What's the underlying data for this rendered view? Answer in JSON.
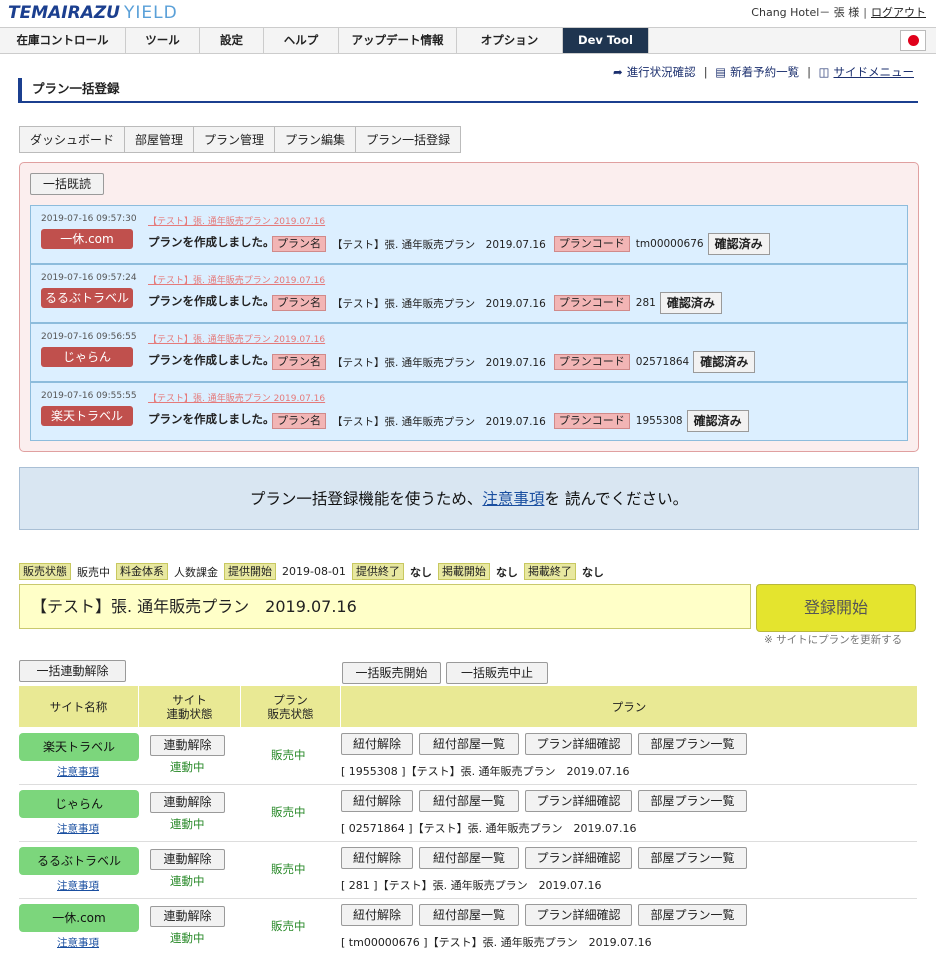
{
  "header": {
    "logo_part1": "TEMAIRAZU",
    "logo_part2": "YIELD",
    "hotel": "Chang Hotel－ 張 様",
    "logout": "ログアウト"
  },
  "nav": [
    "在庫コントロール",
    "ツール",
    "設定",
    "ヘルプ",
    "アップデート情報",
    "オプション",
    "Dev Tool"
  ],
  "toplinks": {
    "progress": "進行状況確認",
    "new_reservations": "新着予約一覧",
    "side_menu": "サイドメニュー"
  },
  "page_title": "プラン一括登録",
  "tabs": [
    "ダッシュボード",
    "部屋管理",
    "プラン管理",
    "プラン編集",
    "プラン一括登録"
  ],
  "read_all_button": "一括既読",
  "notices": [
    {
      "time": "2019-07-16 09:57:30",
      "link": "【テスト】張. 通年販売プラン  2019.07.16",
      "site": "一休.com",
      "message": "プランを作成しました。",
      "plan_name_label": "プラン名",
      "plan_name": "【テスト】張. 通年販売プラン　2019.07.16",
      "plan_code_label": "プランコード",
      "plan_code": "tm00000676",
      "confirm": "確認済み"
    },
    {
      "time": "2019-07-16 09:57:24",
      "link": "【テスト】張. 通年販売プラン  2019.07.16",
      "site": "るるぶトラベル",
      "message": "プランを作成しました。",
      "plan_name_label": "プラン名",
      "plan_name": "【テスト】張. 通年販売プラン　2019.07.16",
      "plan_code_label": "プランコード",
      "plan_code": "281",
      "confirm": "確認済み"
    },
    {
      "time": "2019-07-16 09:56:55",
      "link": "【テスト】張. 通年販売プラン  2019.07.16",
      "site": "じゃらん",
      "message": "プランを作成しました。",
      "plan_name_label": "プラン名",
      "plan_name": "【テスト】張. 通年販売プラン　2019.07.16",
      "plan_code_label": "プランコード",
      "plan_code": "02571864",
      "confirm": "確認済み"
    },
    {
      "time": "2019-07-16 09:55:55",
      "link": "【テスト】張. 通年販売プラン  2019.07.16",
      "site": "楽天トラベル",
      "message": "プランを作成しました。",
      "plan_name_label": "プラン名",
      "plan_name": "【テスト】張. 通年販売プラン　2019.07.16",
      "plan_code_label": "プランコード",
      "plan_code": "1955308",
      "confirm": "確認済み"
    }
  ],
  "banner": {
    "pre": "プラン一括登録機能を使うため、",
    "link": "注意事項",
    "post": "を 読んでください。"
  },
  "status": {
    "sale_status_label": "販売状態",
    "sale_status": "販売中",
    "fee_label": "料金体系",
    "fee": "人数課金",
    "start_label": "提供開始",
    "start": "2019-08-01",
    "end_label": "提供終了",
    "end": "なし",
    "post_start_label": "掲載開始",
    "post_start": "なし",
    "post_end_label": "掲載終了",
    "post_end": "なし"
  },
  "plan_title": "【テスト】張. 通年販売プラン　2019.07.16",
  "start_button": "登録開始",
  "start_note": "※ サイトにプランを更新する",
  "bulk_unlink": "一括連動解除",
  "bulk_sale_start": "一括販売開始",
  "bulk_sale_stop": "一括販売中止",
  "table": {
    "headers": [
      "サイト名称",
      "サイト\n連動状態",
      "プラン\n販売状態",
      "プラン"
    ],
    "rows": [
      {
        "site": "楽天トラベル",
        "note": "注意事項",
        "unlink": "連動解除",
        "link_status": "連動中",
        "sale_status": "販売中",
        "buttons": [
          "紐付解除",
          "紐付部屋一覧",
          "プラン詳細確認",
          "部屋プラン一覧"
        ],
        "plan": "[ 1955308 ]【テスト】張. 通年販売プラン　2019.07.16"
      },
      {
        "site": "じゃらん",
        "note": "注意事項",
        "unlink": "連動解除",
        "link_status": "連動中",
        "sale_status": "販売中",
        "buttons": [
          "紐付解除",
          "紐付部屋一覧",
          "プラン詳細確認",
          "部屋プラン一覧"
        ],
        "plan": "[ 02571864 ]【テスト】張. 通年販売プラン　2019.07.16"
      },
      {
        "site": "るるぶトラベル",
        "note": "注意事項",
        "unlink": "連動解除",
        "link_status": "連動中",
        "sale_status": "販売中",
        "buttons": [
          "紐付解除",
          "紐付部屋一覧",
          "プラン詳細確認",
          "部屋プラン一覧"
        ],
        "plan": "[ 281 ]【テスト】張. 通年販売プラン　2019.07.16"
      },
      {
        "site": "一休.com",
        "note": "注意事項",
        "unlink": "連動解除",
        "link_status": "連動中",
        "sale_status": "販売中",
        "buttons": [
          "紐付解除",
          "紐付部屋一覧",
          "プラン詳細確認",
          "部屋プラン一覧"
        ],
        "plan": "[ tm00000676 ]【テスト】張. 通年販売プラン　2019.07.16"
      }
    ]
  }
}
